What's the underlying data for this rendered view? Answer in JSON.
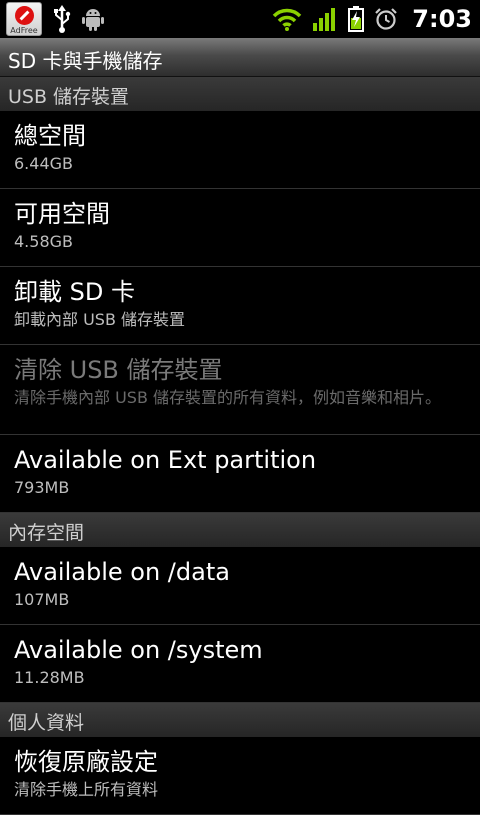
{
  "status_bar": {
    "adfree_label": "AdFree",
    "time": "7:03",
    "icons": [
      "usb-icon",
      "android-debug-icon",
      "wifi-icon",
      "signal-icon",
      "battery-charging-icon",
      "alarm-icon"
    ]
  },
  "title_bar": {
    "title": "SD 卡與手機儲存"
  },
  "sections": {
    "usb": {
      "header": "USB 儲存裝置",
      "items": [
        {
          "title": "總空間",
          "summary": "6.44GB"
        },
        {
          "title": "可用空間",
          "summary": "4.58GB"
        },
        {
          "title": "卸載 SD 卡",
          "summary": "卸載內部 USB 儲存裝置"
        },
        {
          "title": "清除 USB 儲存裝置",
          "summary": "清除手機內部 USB 儲存裝置的所有資料，例如音樂和相片。"
        },
        {
          "title": "Available on Ext partition",
          "summary": "793MB"
        }
      ]
    },
    "internal": {
      "header": "內存空間",
      "items": [
        {
          "title": "Available on /data",
          "summary": "107MB"
        },
        {
          "title": "Available on /system",
          "summary": "11.28MB"
        }
      ]
    },
    "personal": {
      "header": "個人資料",
      "items": [
        {
          "title": "恢復原廠設定",
          "summary": "清除手機上所有資料"
        }
      ]
    }
  },
  "colors": {
    "background": "#000000",
    "section_bg": "#2e2e2e",
    "disabled_text": "#7a7a7a",
    "accent_green": "#8bd100"
  }
}
